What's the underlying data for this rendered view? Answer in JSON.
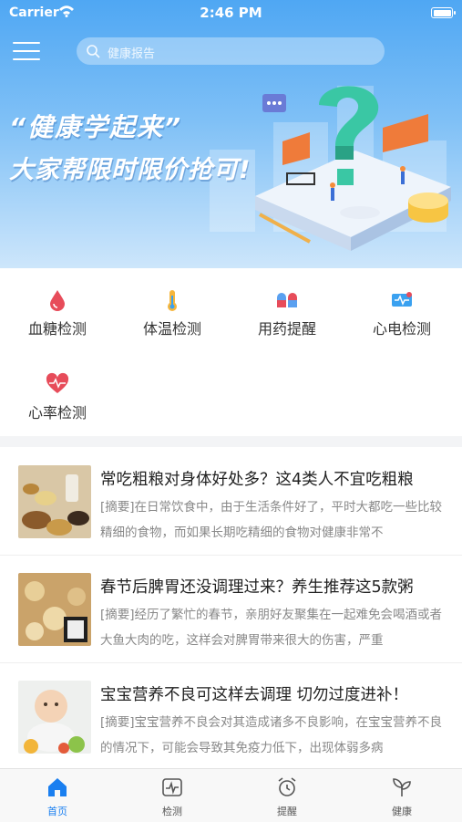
{
  "status_bar": {
    "carrier": "Carrier",
    "time": "2:46 PM"
  },
  "header": {
    "search_placeholder": "健康报告"
  },
  "banner": {
    "slogan_line1": "“健康学起来”",
    "slogan_line2": "大家帮限时限价抢可!"
  },
  "quick_actions": [
    {
      "label": "血糖检测",
      "icon": "blood-drop-icon"
    },
    {
      "label": "体温检测",
      "icon": "thermometer-icon"
    },
    {
      "label": "用药提醒",
      "icon": "pill-icon"
    },
    {
      "label": "心电检测",
      "icon": "ecg-monitor-icon"
    },
    {
      "label": "心率检测",
      "icon": "heart-rate-icon"
    }
  ],
  "articles": [
    {
      "title": "常吃粗粮对身体好处多？这4类人不宜吃粗粮",
      "summary": "[摘要]在日常饮食中，由于生活条件好了，平时大都吃一些比较精细的食物，而如果长期吃精细的食物对健康非常不"
    },
    {
      "title": "春节后脾胃还没调理过来？养生推荐这5款粥",
      "summary": "[摘要]经历了繁忙的春节，亲朋好友聚集在一起难免会喝酒或者大鱼大肉的吃，这样会对脾胃带来很大的伤害，严重"
    },
    {
      "title": "宝宝营养不良可这样去调理 切勿过度进补！",
      "summary": "[摘要]宝宝营养不良会对其造成诸多不良影响，在宝宝营养不良的情况下，可能会导致其免疫力低下，出现体弱多病"
    }
  ],
  "tab_bar": [
    {
      "label": "首页",
      "icon": "home-icon",
      "active": true
    },
    {
      "label": "检测",
      "icon": "monitor-icon"
    },
    {
      "label": "提醒",
      "icon": "alarm-clock-icon"
    },
    {
      "label": "健康",
      "icon": "sprout-icon"
    }
  ],
  "colors": {
    "primary": "#1a7ff0",
    "banner_top": "#4fa7f3",
    "quick_icon_red": "#e74c5a"
  }
}
